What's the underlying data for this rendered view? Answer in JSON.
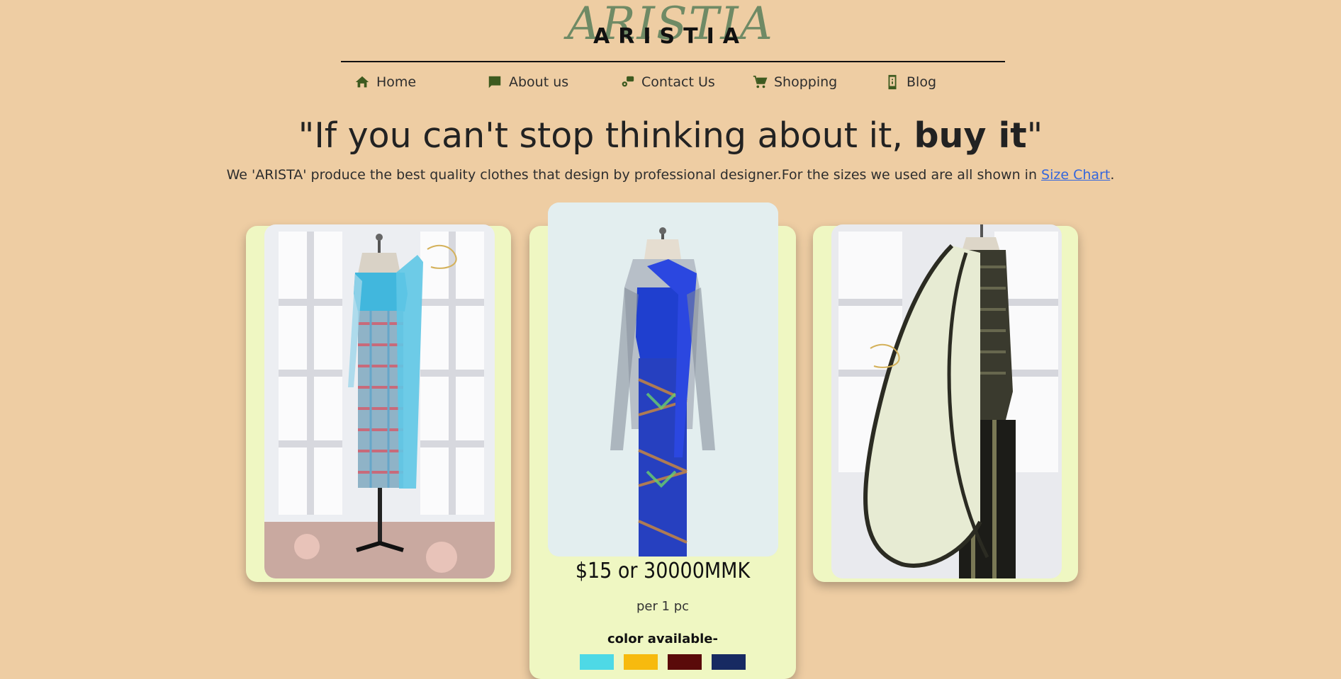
{
  "brand": {
    "logo_script": "ARISTIA",
    "logo_block": "ARISTIA"
  },
  "nav": {
    "items": [
      {
        "label": "Home",
        "icon": "home-icon"
      },
      {
        "label": "About us",
        "icon": "chat-icon"
      },
      {
        "label": "Contact Us",
        "icon": "contact-icon"
      },
      {
        "label": "Shopping",
        "icon": "cart-icon"
      },
      {
        "label": "Blog",
        "icon": "phone-icon"
      }
    ]
  },
  "hero": {
    "headline_open": "\"If you can't stop thinking about it, ",
    "headline_bold": "buy it",
    "headline_close": "\"",
    "subtitle_text": "We 'ARISTA' produce the best quality clothes that design by professional designer.For the sizes we used are all shown in ",
    "subtitle_link": "Size Chart",
    "subtitle_end": "."
  },
  "products": [
    {
      "dress": "turquoise dress",
      "accent": "#41b7dd"
    },
    {
      "dress": "royal blue dress",
      "accent": "#1f3fcf",
      "price": "$15 or 30000MMK",
      "unit": "per 1 pc",
      "color_label": "color available-",
      "colors": [
        "#4ed9e6",
        "#f7ba0e",
        "#5a0a0a",
        "#172a62"
      ]
    },
    {
      "dress": "black and cream dress",
      "accent": "#2a2a1e"
    }
  ]
}
